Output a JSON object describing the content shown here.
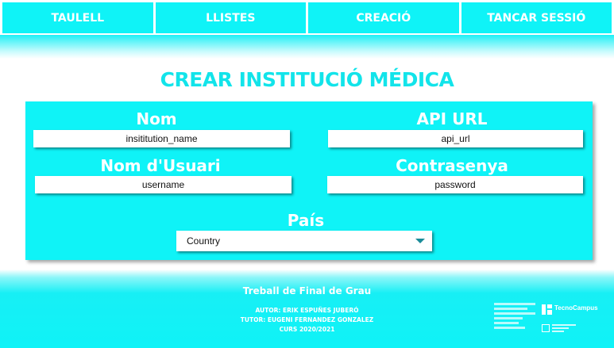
{
  "nav": {
    "items": [
      {
        "label": "TAULELL"
      },
      {
        "label": "LLISTES"
      },
      {
        "label": "CREACIÓ"
      },
      {
        "label": "TANCAR SESSIÓ"
      }
    ]
  },
  "page": {
    "title": "CREAR INSTITUCIÓ MÉDICA"
  },
  "form": {
    "name": {
      "label": "Nom",
      "placeholder": "insititution_name"
    },
    "api_url": {
      "label": "API URL",
      "placeholder": "api_url"
    },
    "username": {
      "label": "Nom d'Usuari",
      "placeholder": "username"
    },
    "password": {
      "label": "Contrasenya",
      "placeholder": "password"
    },
    "country": {
      "label": "País",
      "selected": "Country"
    }
  },
  "footer": {
    "title": "Treball de Final de Grau",
    "author": "AUTOR: ERIK ESPUÑES JUBERÓ",
    "tutor": "TUTOR: EUGENI FERNANDEZ GONZALEZ",
    "course": "CURS 2020/2021",
    "logo_text": "TecnoCampus"
  },
  "colors": {
    "accent": "#0ff3f7",
    "title": "#12e4ea",
    "arrow": "#1b8c99"
  },
  "icons": {
    "dropdown": "chevron-down-icon",
    "logo": "tecnocampus-logo-icon",
    "university": "university-seal-icon"
  }
}
